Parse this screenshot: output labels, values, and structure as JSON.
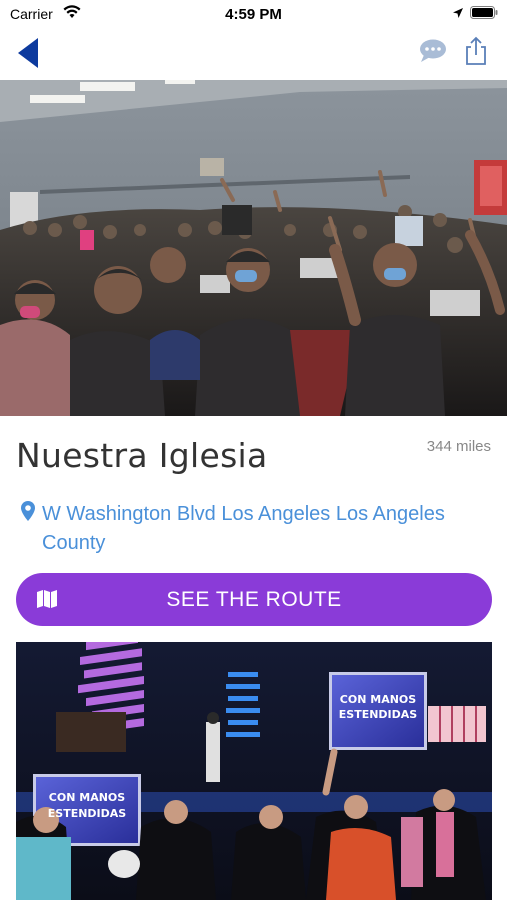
{
  "status_bar": {
    "carrier": "Carrier",
    "time": "4:59 PM"
  },
  "nav": {
    "back_icon": "back-arrow-icon",
    "chat_icon": "chat-bubble-icon",
    "share_icon": "share-icon"
  },
  "place": {
    "name": "Nuestra Iglesia",
    "distance": "344 miles",
    "address": "W Washington Blvd Los Angeles Los Angeles County"
  },
  "route_button": {
    "label": "SEE THE ROUTE",
    "icon": "map-icon"
  },
  "gallery": {
    "screen_text_line1": "CON MANOS",
    "screen_text_line2": "ESTENDIDAS"
  },
  "colors": {
    "accent": "#8a3bd8",
    "link": "#4a90d9",
    "back": "#0d3a9e"
  }
}
